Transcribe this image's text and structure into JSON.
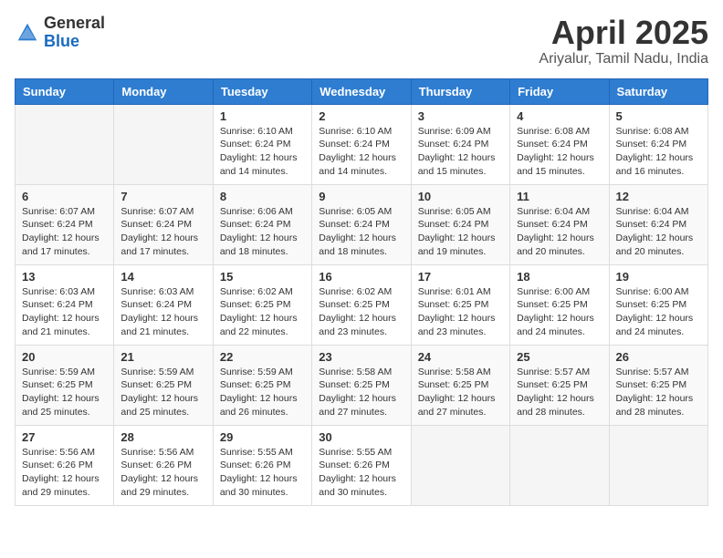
{
  "header": {
    "logo_general": "General",
    "logo_blue": "Blue",
    "month_title": "April 2025",
    "location": "Ariyalur, Tamil Nadu, India"
  },
  "calendar": {
    "days_of_week": [
      "Sunday",
      "Monday",
      "Tuesday",
      "Wednesday",
      "Thursday",
      "Friday",
      "Saturday"
    ],
    "weeks": [
      [
        {
          "day": "",
          "info": ""
        },
        {
          "day": "",
          "info": ""
        },
        {
          "day": "1",
          "info": "Sunrise: 6:10 AM\nSunset: 6:24 PM\nDaylight: 12 hours and 14 minutes."
        },
        {
          "day": "2",
          "info": "Sunrise: 6:10 AM\nSunset: 6:24 PM\nDaylight: 12 hours and 14 minutes."
        },
        {
          "day": "3",
          "info": "Sunrise: 6:09 AM\nSunset: 6:24 PM\nDaylight: 12 hours and 15 minutes."
        },
        {
          "day": "4",
          "info": "Sunrise: 6:08 AM\nSunset: 6:24 PM\nDaylight: 12 hours and 15 minutes."
        },
        {
          "day": "5",
          "info": "Sunrise: 6:08 AM\nSunset: 6:24 PM\nDaylight: 12 hours and 16 minutes."
        }
      ],
      [
        {
          "day": "6",
          "info": "Sunrise: 6:07 AM\nSunset: 6:24 PM\nDaylight: 12 hours and 17 minutes."
        },
        {
          "day": "7",
          "info": "Sunrise: 6:07 AM\nSunset: 6:24 PM\nDaylight: 12 hours and 17 minutes."
        },
        {
          "day": "8",
          "info": "Sunrise: 6:06 AM\nSunset: 6:24 PM\nDaylight: 12 hours and 18 minutes."
        },
        {
          "day": "9",
          "info": "Sunrise: 6:05 AM\nSunset: 6:24 PM\nDaylight: 12 hours and 18 minutes."
        },
        {
          "day": "10",
          "info": "Sunrise: 6:05 AM\nSunset: 6:24 PM\nDaylight: 12 hours and 19 minutes."
        },
        {
          "day": "11",
          "info": "Sunrise: 6:04 AM\nSunset: 6:24 PM\nDaylight: 12 hours and 20 minutes."
        },
        {
          "day": "12",
          "info": "Sunrise: 6:04 AM\nSunset: 6:24 PM\nDaylight: 12 hours and 20 minutes."
        }
      ],
      [
        {
          "day": "13",
          "info": "Sunrise: 6:03 AM\nSunset: 6:24 PM\nDaylight: 12 hours and 21 minutes."
        },
        {
          "day": "14",
          "info": "Sunrise: 6:03 AM\nSunset: 6:24 PM\nDaylight: 12 hours and 21 minutes."
        },
        {
          "day": "15",
          "info": "Sunrise: 6:02 AM\nSunset: 6:25 PM\nDaylight: 12 hours and 22 minutes."
        },
        {
          "day": "16",
          "info": "Sunrise: 6:02 AM\nSunset: 6:25 PM\nDaylight: 12 hours and 23 minutes."
        },
        {
          "day": "17",
          "info": "Sunrise: 6:01 AM\nSunset: 6:25 PM\nDaylight: 12 hours and 23 minutes."
        },
        {
          "day": "18",
          "info": "Sunrise: 6:00 AM\nSunset: 6:25 PM\nDaylight: 12 hours and 24 minutes."
        },
        {
          "day": "19",
          "info": "Sunrise: 6:00 AM\nSunset: 6:25 PM\nDaylight: 12 hours and 24 minutes."
        }
      ],
      [
        {
          "day": "20",
          "info": "Sunrise: 5:59 AM\nSunset: 6:25 PM\nDaylight: 12 hours and 25 minutes."
        },
        {
          "day": "21",
          "info": "Sunrise: 5:59 AM\nSunset: 6:25 PM\nDaylight: 12 hours and 25 minutes."
        },
        {
          "day": "22",
          "info": "Sunrise: 5:59 AM\nSunset: 6:25 PM\nDaylight: 12 hours and 26 minutes."
        },
        {
          "day": "23",
          "info": "Sunrise: 5:58 AM\nSunset: 6:25 PM\nDaylight: 12 hours and 27 minutes."
        },
        {
          "day": "24",
          "info": "Sunrise: 5:58 AM\nSunset: 6:25 PM\nDaylight: 12 hours and 27 minutes."
        },
        {
          "day": "25",
          "info": "Sunrise: 5:57 AM\nSunset: 6:25 PM\nDaylight: 12 hours and 28 minutes."
        },
        {
          "day": "26",
          "info": "Sunrise: 5:57 AM\nSunset: 6:25 PM\nDaylight: 12 hours and 28 minutes."
        }
      ],
      [
        {
          "day": "27",
          "info": "Sunrise: 5:56 AM\nSunset: 6:26 PM\nDaylight: 12 hours and 29 minutes."
        },
        {
          "day": "28",
          "info": "Sunrise: 5:56 AM\nSunset: 6:26 PM\nDaylight: 12 hours and 29 minutes."
        },
        {
          "day": "29",
          "info": "Sunrise: 5:55 AM\nSunset: 6:26 PM\nDaylight: 12 hours and 30 minutes."
        },
        {
          "day": "30",
          "info": "Sunrise: 5:55 AM\nSunset: 6:26 PM\nDaylight: 12 hours and 30 minutes."
        },
        {
          "day": "",
          "info": ""
        },
        {
          "day": "",
          "info": ""
        },
        {
          "day": "",
          "info": ""
        }
      ]
    ]
  }
}
